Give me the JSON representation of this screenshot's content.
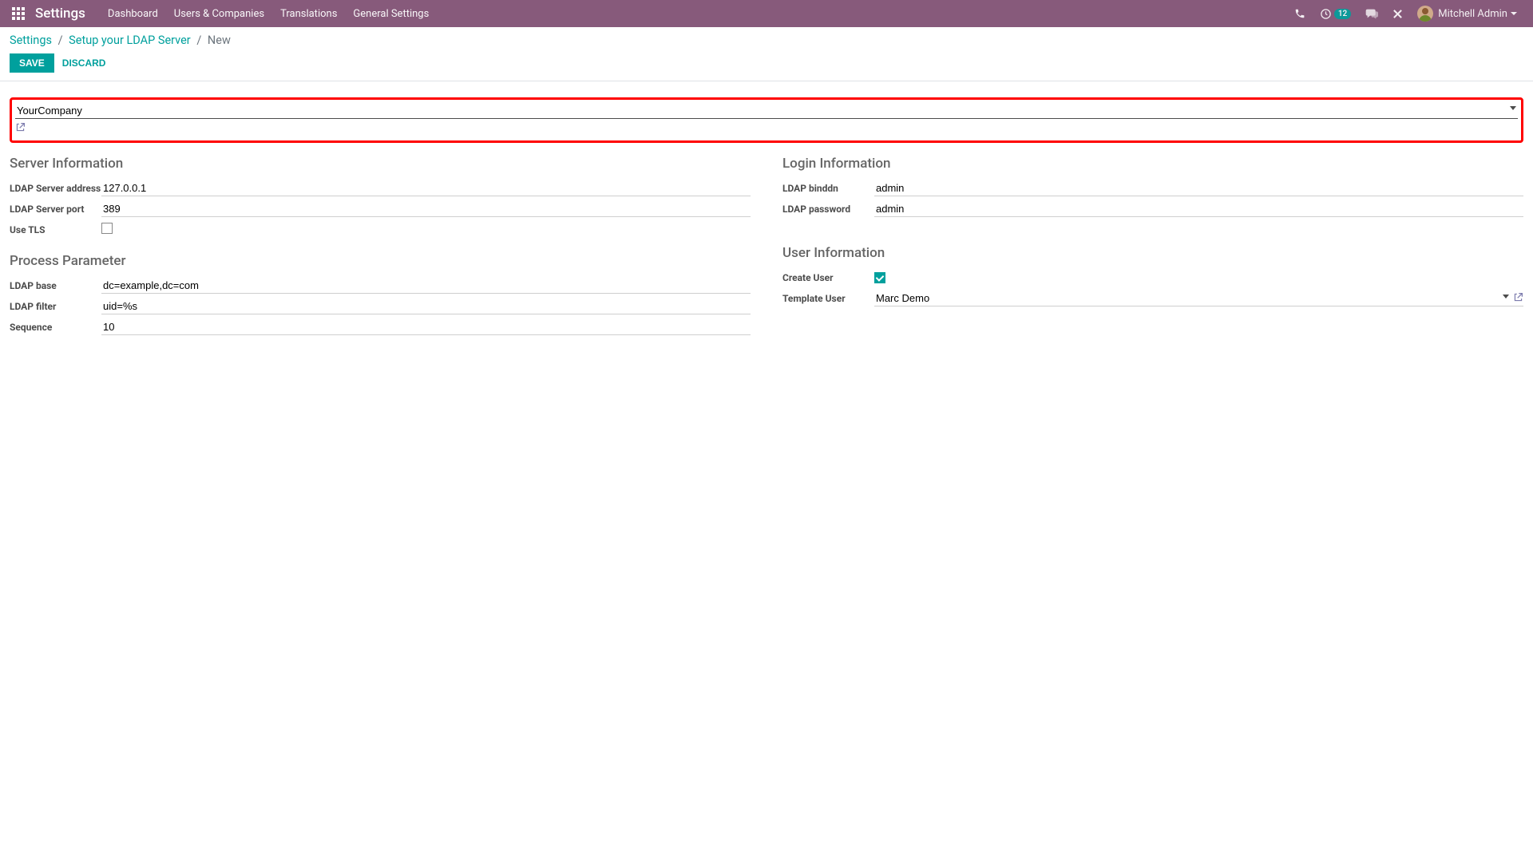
{
  "topbar": {
    "app_title": "Settings",
    "menu": [
      "Dashboard",
      "Users & Companies",
      "Translations",
      "General Settings"
    ],
    "activity_count": "12",
    "user_name": "Mitchell Admin"
  },
  "breadcrumb": {
    "root": "Settings",
    "parent": "Setup your LDAP Server",
    "current": "New"
  },
  "buttons": {
    "save": "SAVE",
    "discard": "DISCARD"
  },
  "company": {
    "value": "YourCompany"
  },
  "sections": {
    "server_info_title": "Server Information",
    "login_info_title": "Login Information",
    "process_param_title": "Process Parameter",
    "user_info_title": "User Information"
  },
  "fields": {
    "ldap_server_address": {
      "label": "LDAP Server address",
      "value": "127.0.0.1"
    },
    "ldap_server_port": {
      "label": "LDAP Server port",
      "value": "389"
    },
    "use_tls": {
      "label": "Use TLS",
      "checked": false
    },
    "ldap_binddn": {
      "label": "LDAP binddn",
      "value": "admin"
    },
    "ldap_password": {
      "label": "LDAP password",
      "value": "admin"
    },
    "ldap_base": {
      "label": "LDAP base",
      "value": "dc=example,dc=com"
    },
    "ldap_filter": {
      "label": "LDAP filter",
      "value": "uid=%s"
    },
    "sequence": {
      "label": "Sequence",
      "value": "10"
    },
    "create_user": {
      "label": "Create User",
      "checked": true
    },
    "template_user": {
      "label": "Template User",
      "value": "Marc Demo"
    }
  }
}
